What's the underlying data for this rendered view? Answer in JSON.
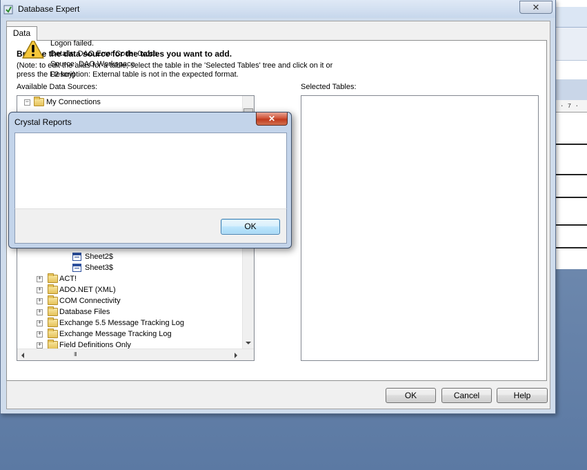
{
  "background_app": {
    "ruler_text": "· 7 ·"
  },
  "window": {
    "title": "Database Expert",
    "close_glyph": "✕"
  },
  "tabs": [
    {
      "label": "Data"
    }
  ],
  "main": {
    "heading": "Browse the data source for the tables you want to add.",
    "note": "(Note: to edit the alias for a table, select the table in the 'Selected Tables' tree and click on it or press the F2 key)",
    "available_label": "Available Data Sources:",
    "selected_label": "Selected Tables:"
  },
  "tree": {
    "items": [
      {
        "label": "My Connections",
        "expander": "−",
        "icon": "folder-icon"
      },
      {
        "label": "Sheet2$",
        "icon": "sheet-icon"
      },
      {
        "label": "Sheet3$",
        "icon": "sheet-icon"
      },
      {
        "label": "ACT!",
        "expander": "+",
        "icon": "folder-icon"
      },
      {
        "label": "ADO.NET (XML)",
        "expander": "+",
        "icon": "folder-icon"
      },
      {
        "label": "COM Connectivity",
        "expander": "+",
        "icon": "folder-icon"
      },
      {
        "label": "Database Files",
        "expander": "+",
        "icon": "folder-icon"
      },
      {
        "label": "Exchange 5.5 Message Tracking Log",
        "expander": "+",
        "icon": "folder-icon"
      },
      {
        "label": "Exchange Message Tracking Log",
        "expander": "+",
        "icon": "folder-icon"
      },
      {
        "label": "Field Definitions Only",
        "expander": "+",
        "icon": "folder-icon"
      }
    ],
    "hscroll_grip": "III"
  },
  "buttons": {
    "ok": "OK",
    "cancel": "Cancel",
    "help": "Help"
  },
  "dialog": {
    "title": "Crystal Reports",
    "close_glyph": "✕",
    "icon": "warning-icon",
    "lines": [
      "Logon failed.",
      "Details: DAO Error Code: 0xcca",
      "Source: DAO.Workspace",
      "Description: External table is not in the expected format."
    ],
    "ok_label": "OK"
  }
}
